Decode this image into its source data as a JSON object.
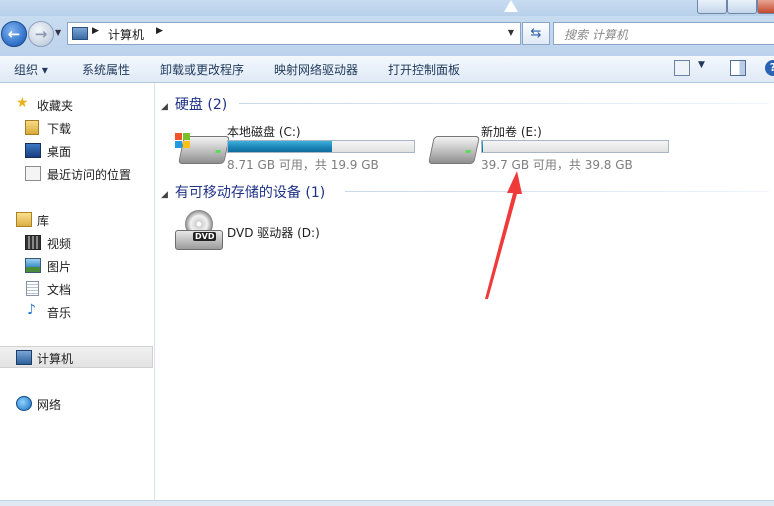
{
  "address": {
    "breadcrumb": "计算机",
    "search_placeholder": "搜索 计算机"
  },
  "toolbar": {
    "items": [
      "组织 ▾",
      "系统属性",
      "卸载或更改程序",
      "映射网络驱动器",
      "打开控制面板"
    ]
  },
  "nav": {
    "favorites": "收藏夹",
    "downloads": "下载",
    "desktop": "桌面",
    "recent": "最近访问的位置",
    "libraries": "库",
    "videos": "视频",
    "pictures": "图片",
    "documents": "文档",
    "music": "音乐",
    "computer": "计算机",
    "network": "网络"
  },
  "groups": {
    "hard_disks": "硬盘 (2)",
    "removable": "有可移动存储的设备 (1)"
  },
  "drives": [
    {
      "name": "本地磁盘 (C:)",
      "free_text": "8.71 GB 可用，共 19.9 GB",
      "used_fraction": 0.56
    },
    {
      "name": "新加卷 (E:)",
      "free_text": "39.7 GB 可用，共 39.8 GB",
      "used_fraction": 0.003
    }
  ],
  "removable": [
    {
      "name": "DVD 驱动器 (D:)",
      "badge": "DVD"
    }
  ],
  "colors": {
    "accent_blue": "#1e3287",
    "bar_fill": "#1c86b9",
    "annotation_arrow": "#f03a3a"
  }
}
